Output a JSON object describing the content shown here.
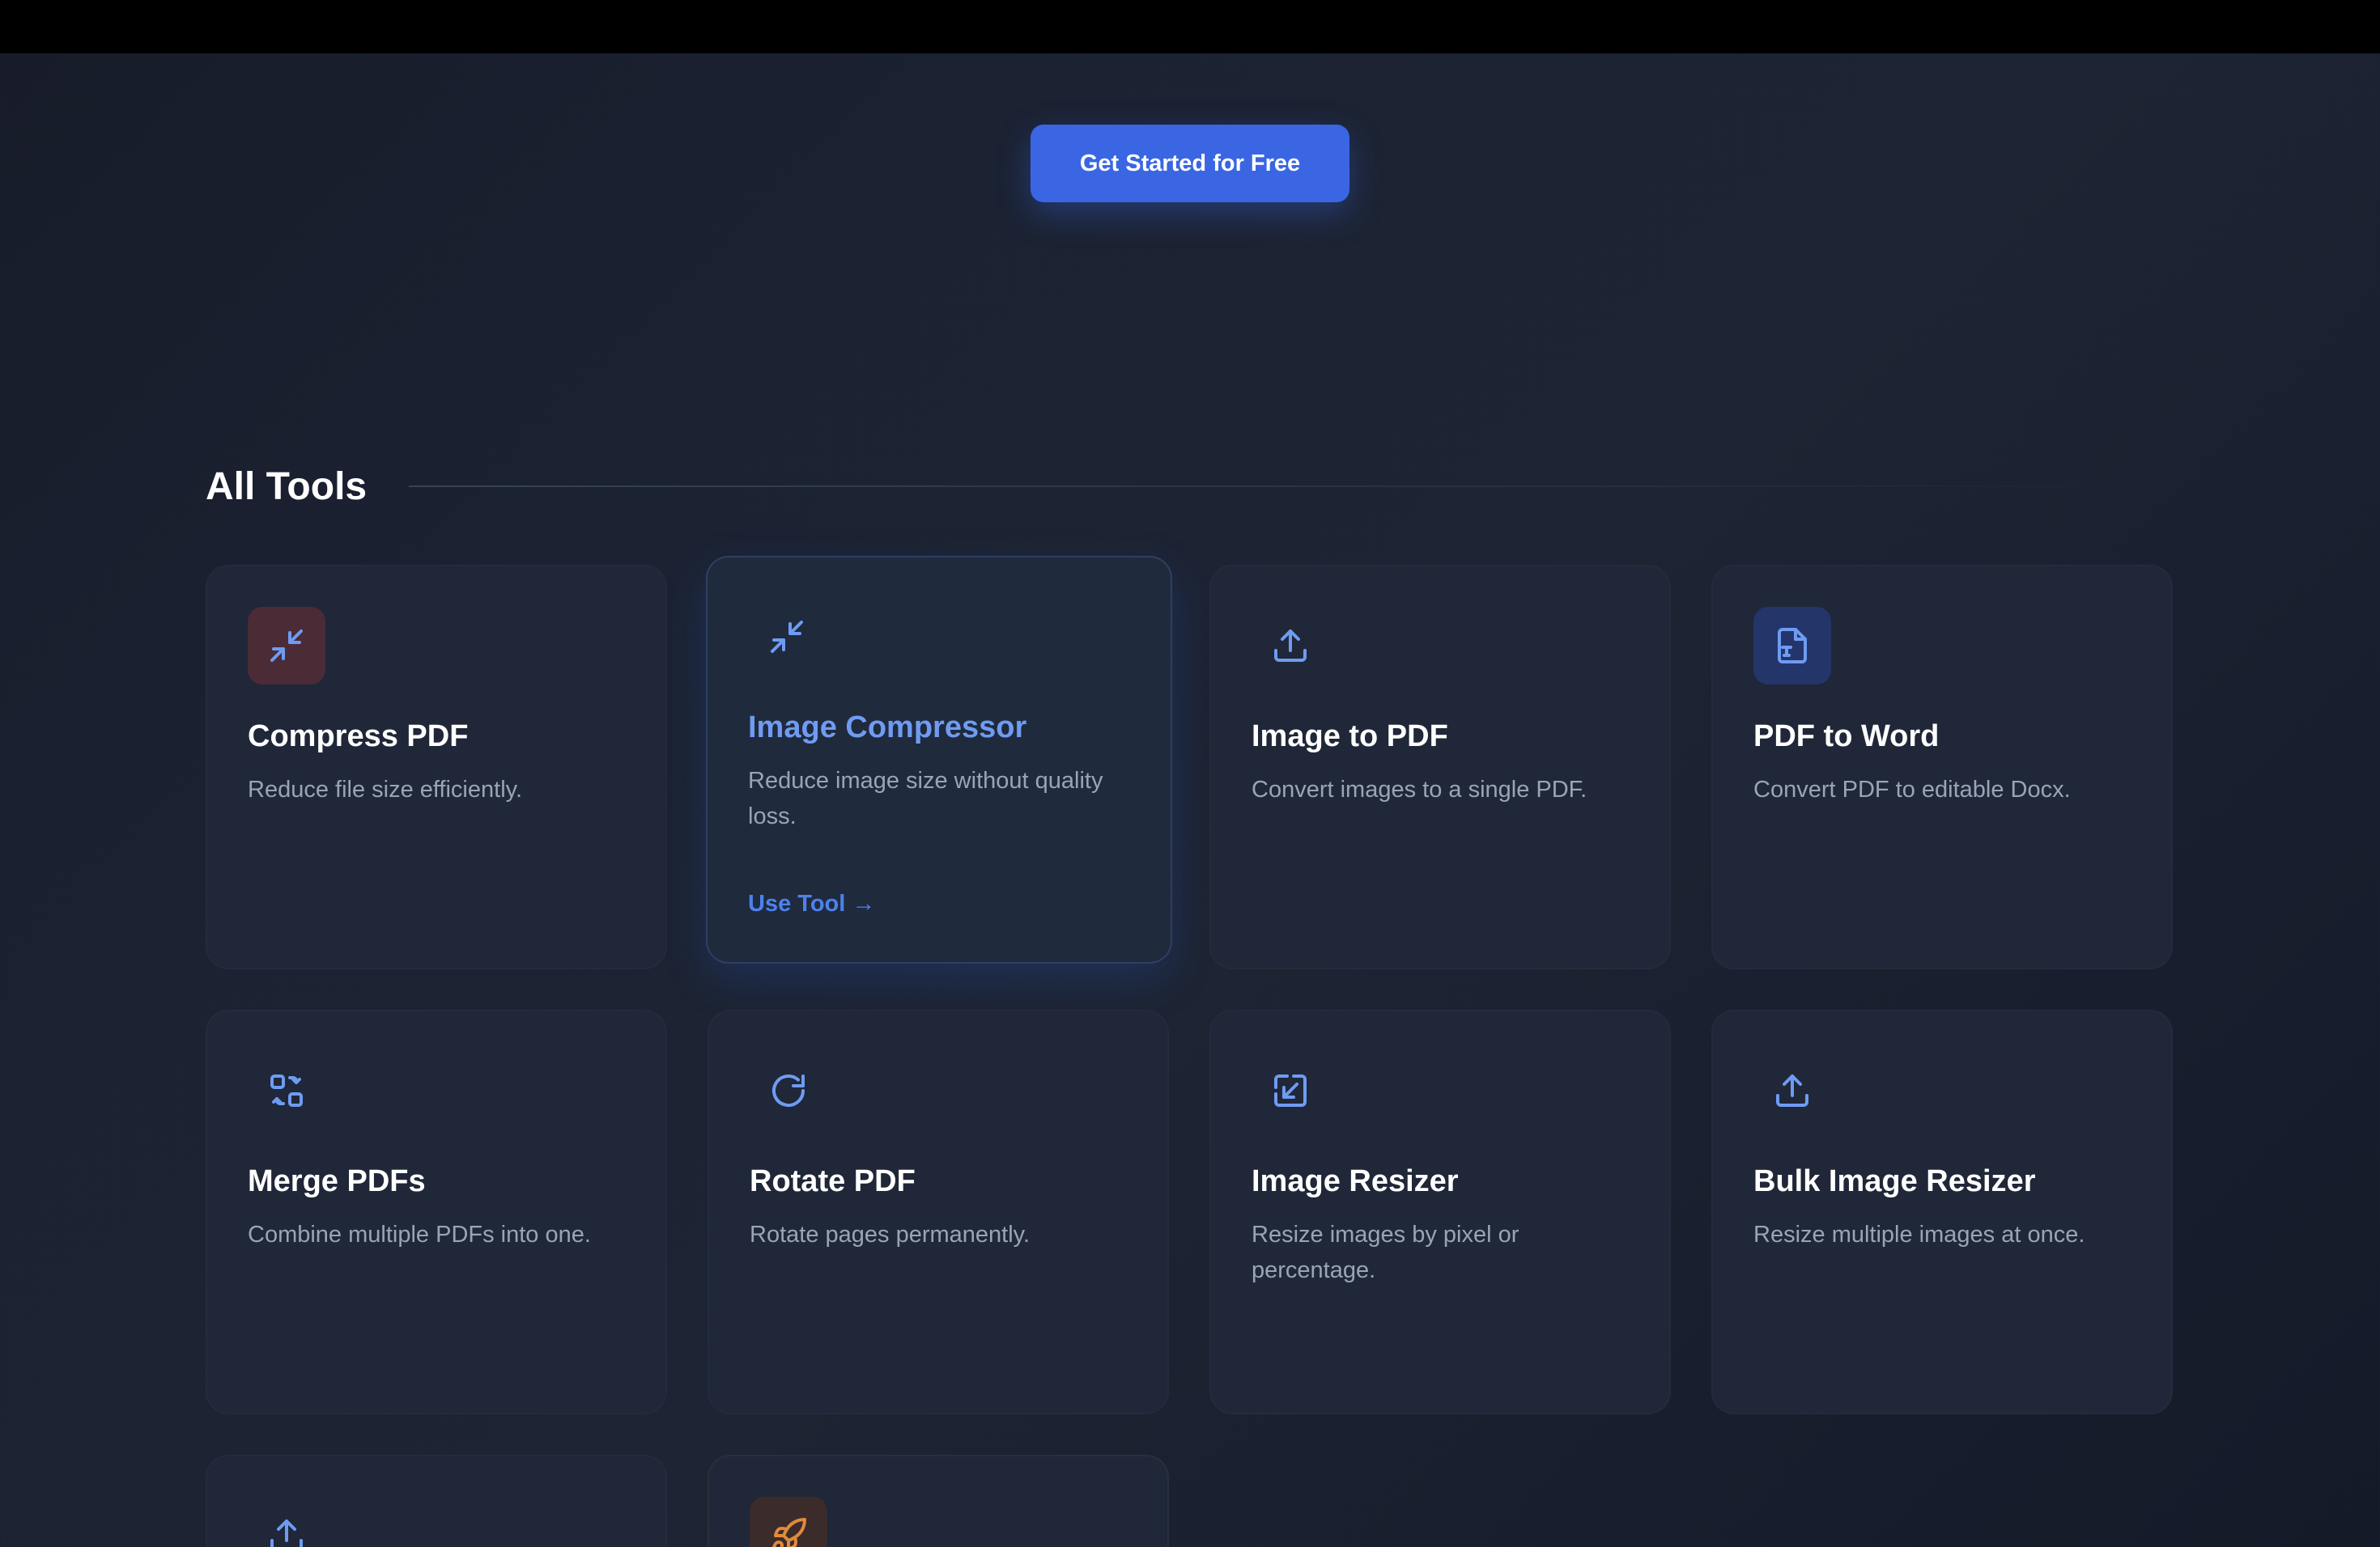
{
  "hero": {
    "cta_label": "Get Started for Free"
  },
  "section": {
    "title": "All Tools"
  },
  "colors": {
    "accent": "#3a66e4",
    "link": "#4b82ec",
    "active_title": "#6f9bf2",
    "card_bg": "#1f2738",
    "page_bg": "#1b2232"
  },
  "tools": [
    {
      "title": "Compress PDF",
      "desc": "Reduce file size efficiently.",
      "icon": "compress-icon"
    },
    {
      "title": "Image Compressor",
      "desc": "Reduce image size without quality loss.",
      "icon": "compress-icon",
      "link": "Use Tool →",
      "state": "hovered"
    },
    {
      "title": "Image to PDF",
      "desc": "Convert images to a single PDF.",
      "icon": "upload-icon"
    },
    {
      "title": "PDF to Word",
      "desc": "Convert PDF to editable Docx.",
      "icon": "file-text-icon"
    },
    {
      "title": "Merge PDFs",
      "desc": "Combine multiple PDFs into one.",
      "icon": "merge-icon"
    },
    {
      "title": "Rotate PDF",
      "desc": "Rotate pages permanently.",
      "icon": "rotate-icon"
    },
    {
      "title": "Image Resizer",
      "desc": "Resize images by pixel or percentage.",
      "icon": "resize-icon"
    },
    {
      "title": "Bulk Image Resizer",
      "desc": "Resize multiple images at once.",
      "icon": "upload-icon"
    },
    {
      "icon": "upload-icon"
    },
    {
      "icon": "rocket-icon"
    }
  ]
}
